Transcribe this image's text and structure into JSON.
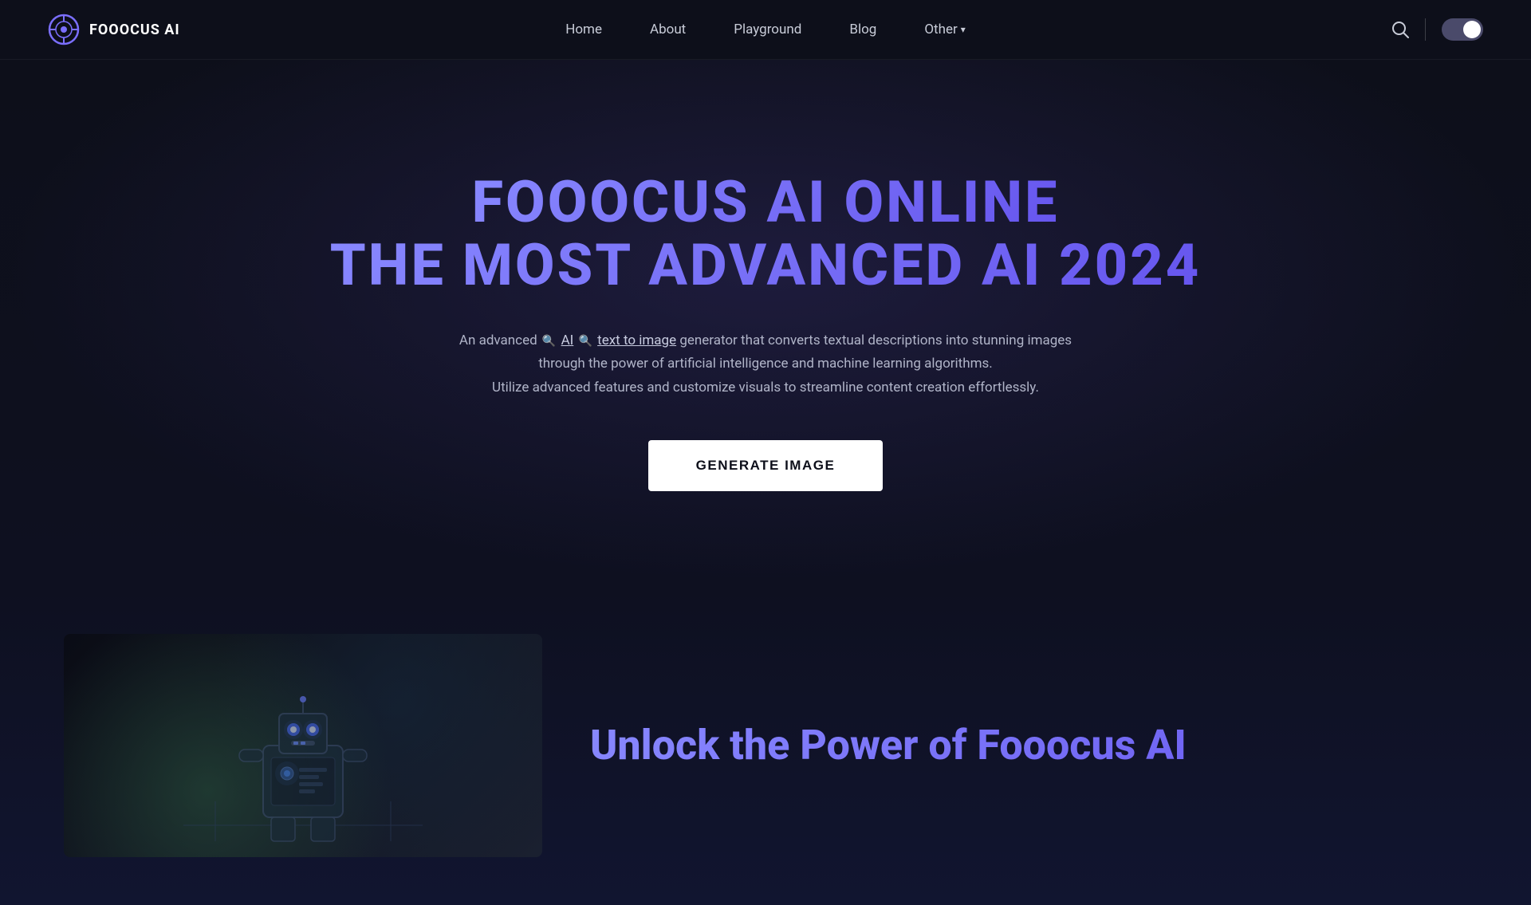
{
  "brand": {
    "name": "FOOOCUS AI",
    "logo_alt": "Fooocus AI Logo"
  },
  "nav": {
    "home_label": "Home",
    "about_label": "About",
    "playground_label": "Playground",
    "blog_label": "Blog",
    "other_label": "Other",
    "other_chevron": "▾"
  },
  "hero": {
    "title_line1": "FOOOCUS AI ONLINE",
    "title_line2": "THE MOST ADVANCED AI 2024",
    "description_line1": "An advanced  AI  text to image generator that converts textual descriptions into stunning images",
    "description_line2": "through the power of artificial intelligence and machine learning algorithms.",
    "description_line3": "Utilize advanced features and customize visuals to streamline content creation effortlessly.",
    "cta_label": "GENERATE IMAGE"
  },
  "lower": {
    "title": "Unlock the Power of Fooocus AI"
  },
  "toggle": {
    "state": "dark"
  }
}
